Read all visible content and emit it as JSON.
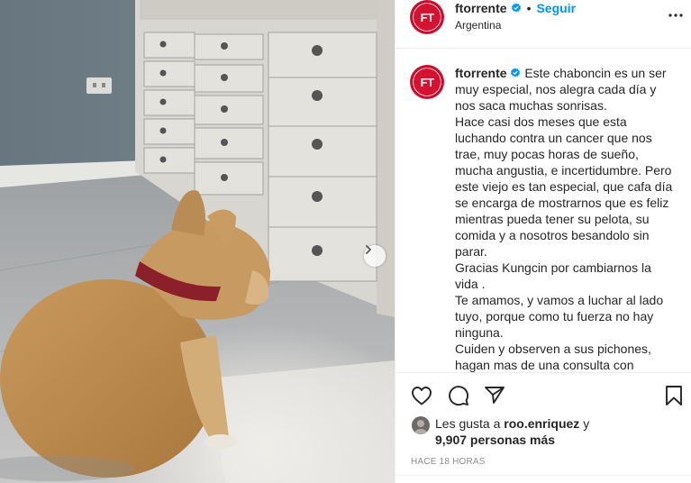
{
  "post": {
    "username": "ftorrente",
    "follow_label": "Seguir",
    "separator": "•",
    "location": "Argentina",
    "avatar_initials": "FT",
    "icons": {
      "verified": "verified-badge-icon",
      "more": "more-options-icon",
      "next": "chevron-right-icon",
      "like": "heart-icon",
      "comment": "comment-icon",
      "share": "paper-plane-icon",
      "save": "bookmark-icon"
    },
    "colors": {
      "accent": "#0095f6",
      "brand_red": "#d41231",
      "verified": "#0095f6"
    }
  },
  "caption": {
    "first_line": "Este chaboncin es un ser",
    "lines": [
      "muy especial, nos alegra cada día y",
      "nos saca muchas sonrisas.",
      "Hace casi dos meses que esta",
      "luchando contra un cancer que nos",
      "trae, muy pocas horas de sueño,",
      "mucha angustia, e incertidumbre. Pero",
      "este viejo es tan especial, que cafa día",
      "se encarga de mostrarnos que es feliz",
      "mientras pueda tener su pelota, su",
      "comida y a nosotros besandolo sin",
      "parar.",
      "Gracias Kungcin por cambiarnos la",
      "vida .",
      "Te amamos, y vamos a luchar al lado",
      "tuyo, porque como tu fuerza no hay",
      "ninguna.",
      "Cuiden y observen a sus pichones,",
      "hagan mas de una consulta con"
    ]
  },
  "likes": {
    "prefix": "Les gusta a",
    "user": "roo.enriquez",
    "conjunction": "y",
    "count": "9,907 personas más"
  },
  "timestamp": "HACE 18 HORAS"
}
